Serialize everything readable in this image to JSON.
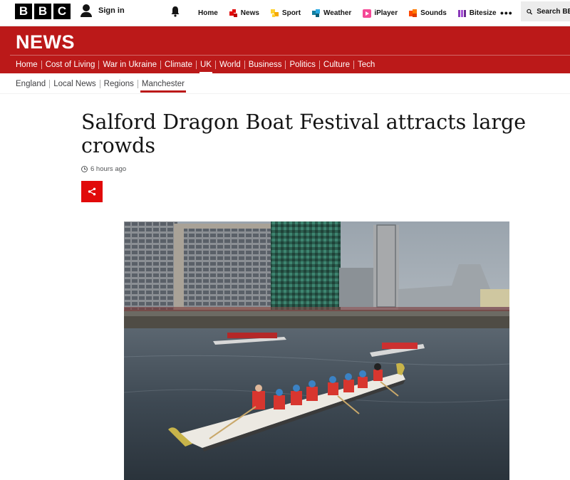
{
  "topbar": {
    "logo_letters": [
      "B",
      "B",
      "C"
    ],
    "signin_label": "Sign in",
    "nav": [
      {
        "label": "Home",
        "icon": "none"
      },
      {
        "label": "News",
        "icon": "news-icon"
      },
      {
        "label": "Sport",
        "icon": "sport-icon"
      },
      {
        "label": "Weather",
        "icon": "weather-icon"
      },
      {
        "label": "iPlayer",
        "icon": "iplayer-icon"
      },
      {
        "label": "Sounds",
        "icon": "sounds-icon"
      },
      {
        "label": "Bitesize",
        "icon": "bitesize-icon"
      }
    ],
    "more_label": "•••",
    "search_label": "Search BBC"
  },
  "news": {
    "title": "NEWS",
    "nav": [
      "Home",
      "Cost of Living",
      "War in Ukraine",
      "Climate",
      "UK",
      "World",
      "Business",
      "Politics",
      "Culture",
      "Tech"
    ],
    "active": "UK"
  },
  "subnav": {
    "items": [
      "England",
      "Local News",
      "Regions",
      "Manchester"
    ],
    "active": "Manchester"
  },
  "article": {
    "headline": "Salford Dragon Boat Festival attracts large crowds",
    "timestamp": "6 hours ago"
  },
  "colors": {
    "brand_red": "#bb1919",
    "share_red": "#e10a0a"
  }
}
